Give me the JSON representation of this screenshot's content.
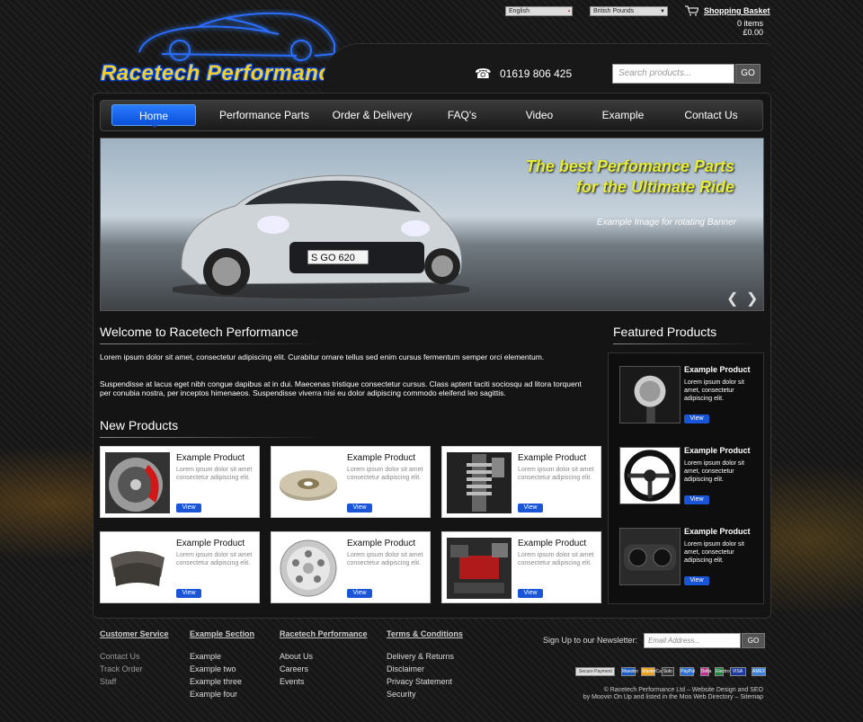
{
  "topbar": {
    "language": "English",
    "currency": "British Pounds",
    "basket_label": "Shopping Basket",
    "basket_items": "0 items",
    "basket_total": "£0.00"
  },
  "header": {
    "logo_text": "Racetech Performance",
    "phone": "01619 806 425",
    "search_placeholder": "Search products...",
    "search_button": "GO"
  },
  "nav": {
    "items": [
      "Home",
      "Performance Parts",
      "Order & Delivery",
      "FAQ's",
      "Video",
      "Example",
      "Contact Us"
    ]
  },
  "banner": {
    "headline_line1": "The best Perfomance Parts",
    "headline_line2": "for the Ultimate Ride",
    "caption": "Example Image for rotating Banner",
    "plate": "S GO 620"
  },
  "welcome": {
    "title": "Welcome to Racetech Performance",
    "para1": "Lorem ipsum dolor sit amet, consectetur adipiscing elit. Curabitur ornare tellus sed enim cursus fermentum semper orci elementum.",
    "para2": "Suspendisse at lacus eget nibh congue dapibus at in dui. Maecenas tristique consectetur cursus. Class aptent taciti sociosqu ad litora torquent per conubia nostra, per inceptos himenaeos. Suspendisse viverra nisi eu dolor adipiscing commodo eleifend leo sagittis."
  },
  "new_products": {
    "title": "New Products",
    "items": [
      {
        "title": "Example Product",
        "desc": "Lorem ipsum dolor sit amet consectetur adipiscing elit.",
        "button": "View",
        "image": "brake-caliper-wheel"
      },
      {
        "title": "Example Product",
        "desc": "Lorem ipsum dolor sit amet consectetur adipiscing elit.",
        "button": "View",
        "image": "brake-disc"
      },
      {
        "title": "Example Product",
        "desc": "Lorem ipsum dolor sit amet consectetur adipiscing elit.",
        "button": "View",
        "image": "suspension-coilover"
      },
      {
        "title": "Example Product",
        "desc": "Lorem ipsum dolor sit amet consectetur adipiscing elit.",
        "button": "View",
        "image": "brake-pads"
      },
      {
        "title": "Example Product",
        "desc": "Lorem ipsum dolor sit amet consectetur adipiscing elit.",
        "button": "View",
        "image": "alloy-wheel"
      },
      {
        "title": "Example Product",
        "desc": "Lorem ipsum dolor sit amet consectetur adipiscing elit.",
        "button": "View",
        "image": "engine-bay"
      }
    ]
  },
  "featured": {
    "title": "Featured Products",
    "items": [
      {
        "title": "Example Product",
        "desc": "Lorem ipsum dolor sit amet, consectetur adipiscing elit.",
        "button": "View",
        "image": "gear-knob"
      },
      {
        "title": "Example Product",
        "desc": "Lorem ipsum dolor sit amet, consectetur adipiscing elit.",
        "button": "View",
        "image": "steering-wheel"
      },
      {
        "title": "Example Product",
        "desc": "Lorem ipsum dolor sit amet, consectetur adipiscing elit.",
        "button": "View",
        "image": "gauges"
      }
    ]
  },
  "footer": {
    "columns": [
      {
        "heading": "Customer Service",
        "links": [
          "Contact Us",
          "Track Order",
          "Staff"
        ]
      },
      {
        "heading": "Example Section",
        "links": [
          "Example",
          "Example two",
          "Example three",
          "Example four"
        ]
      },
      {
        "heading": "Racetech Performance",
        "links": [
          "About Us",
          "Careers",
          "Events"
        ]
      },
      {
        "heading": "Terms & Conditions",
        "links": [
          "Delivery & Returns",
          "Disclaimer",
          "Privacy Statement",
          "Security"
        ]
      }
    ],
    "newsletter_label": "Sign Up to our Newsletter:",
    "newsletter_placeholder": "Email Address...",
    "newsletter_button": "GO",
    "payment_cards": [
      "Secure Payment",
      "Maestro",
      "MasterCard",
      "Solo",
      "PayPal",
      "Delta",
      "Electron",
      "VISA",
      "AMEX"
    ],
    "copyright_line1": "© Racetech Performance Ltd – Website Design and SEO",
    "copyright_line2": "by Moovin On Up and listed in the Moo Web Directory – Sitemap"
  },
  "colors": {
    "accent_blue": "#1a55d8",
    "banner_yellow": "#e6ec38",
    "logo_yellow": "#f0d030"
  }
}
